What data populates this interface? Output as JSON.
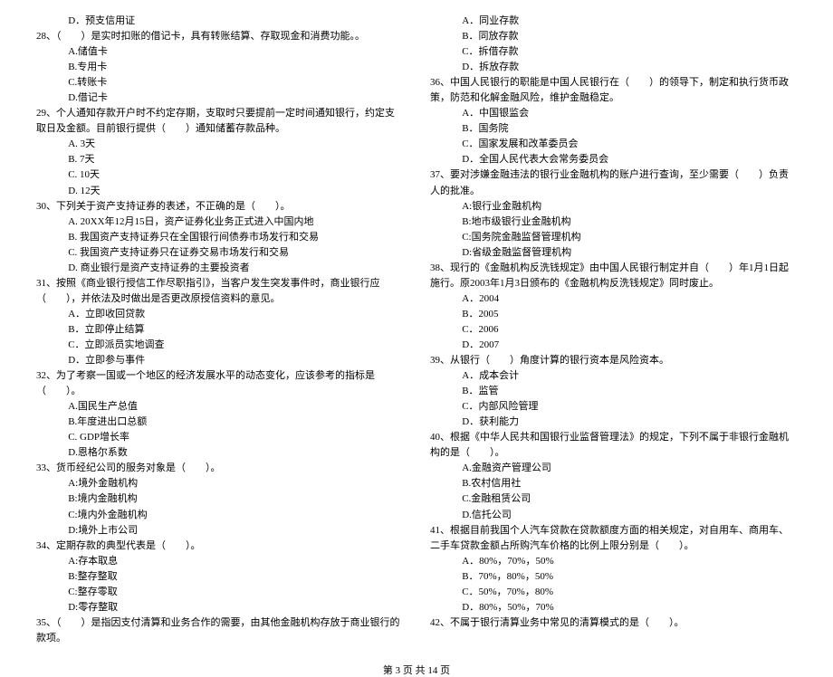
{
  "left": {
    "q27d": "D．预支信用证",
    "q28": "28、（　　）是实时扣账的借记卡，具有转账结算、存取现金和消费功能。。",
    "q28a": "A.储值卡",
    "q28b": "B.专用卡",
    "q28c": "C.转账卡",
    "q28d": "D.借记卡",
    "q29": "29、个人通知存款开户时不约定存期，支取时只要提前一定时间通知银行，约定支取日及金额。目前银行提供（　　）通知储蓄存款品种。",
    "q29a": "A. 3天",
    "q29b": "B. 7天",
    "q29c": "C. 10天",
    "q29d": "D. 12天",
    "q30": "30、下列关于资产支持证券的表述，不正确的是（　　）。",
    "q30a": "A. 20XX年12月15日，资产证券化业务正式进入中国内地",
    "q30b": "B. 我国资产支持证券只在全国银行间债券市场发行和交易",
    "q30c": "C. 我国资产支持证券只在证券交易市场发行和交易",
    "q30d": "D. 商业银行是资产支持证券的主要投资者",
    "q31": "31、按照《商业银行授信工作尽职指引》，当客户发生突发事件时，商业银行应（　　），并依法及时做出是否更改原授信资料的意见。",
    "q31a": "A．立即收回贷款",
    "q31b": "B．立即停止结算",
    "q31c": "C．立即派员实地调查",
    "q31d": "D．立即参与事件",
    "q32": "32、为了考察一国或一个地区的经济发展水平的动态变化，应该参考的指标是（　　）。",
    "q32a": "A.国民生产总值",
    "q32b": "B.年度进出口总额",
    "q32c": "C. GDP增长率",
    "q32d": "D.恩格尔系数",
    "q33": "33、货币经纪公司的服务对象是（　　）。",
    "q33a": "A:境外金融机构",
    "q33b": "B:境内金融机构",
    "q33c": "C:境内外金融机构",
    "q33d": "D:境外上市公司",
    "q34": "34、定期存款的典型代表是（　　）。",
    "q34a": "A:存本取息",
    "q34b": "B:整存整取",
    "q34c": "C:整存零取",
    "q34d": "D:零存整取",
    "q35": "35、（　　）是指因支付清算和业务合作的需要，由其他金融机构存放于商业银行的款项。"
  },
  "right": {
    "q35a": "A．同业存款",
    "q35b": "B．同放存款",
    "q35c": "C．拆借存款",
    "q35d": "D．拆放存款",
    "q36": "36、中国人民银行的职能是中国人民银行在（　　）的领导下，制定和执行货币政策，防范和化解金融风险，维护金融稳定。",
    "q36a": "A．中国银监会",
    "q36b": "B．国务院",
    "q36c": "C．国家发展和改革委员会",
    "q36d": "D．全国人民代表大会常务委员会",
    "q37": "37、要对涉嫌金融违法的银行业金融机构的账户进行查询，至少需要（　　）负责人的批准。",
    "q37a": "A:银行业金融机构",
    "q37b": "B:地市级银行业金融机构",
    "q37c": "C:国务院金融监督管理机构",
    "q37d": "D:省级金融监督管理机构",
    "q38": "38、现行的《金融机构反洗钱规定》由中国人民银行制定并自（　　）年1月1日起施行。原2003年1月3日颁布的《金融机构反洗钱规定》同时废止。",
    "q38a": "A．2004",
    "q38b": "B．2005",
    "q38c": "C．2006",
    "q38d": "D．2007",
    "q39": "39、从银行（　　）角度计算的银行资本是风险资本。",
    "q39a": "A．成本会计",
    "q39b": "B．监管",
    "q39c": "C．内部风险管理",
    "q39d": "D．获利能力",
    "q40": "40、根据《中华人民共和国银行业监督管理法》的规定，下列不属于非银行金融机构的是（　　）。",
    "q40a": "A.金融资产管理公司",
    "q40b": "B.农村信用社",
    "q40c": "C.金融租赁公司",
    "q40d": "D.信托公司",
    "q41": "41、根据目前我国个人汽车贷款在贷款额度方面的相关规定，对自用车、商用车、二手车贷款金额占所购汽车价格的比例上限分别是（　　）。",
    "q41a": "A．80%，70%，50%",
    "q41b": "B．70%，80%，50%",
    "q41c": "C．50%，70%，80%",
    "q41d": "D．80%，50%，70%",
    "q42": "42、不属于银行清算业务中常见的清算模式的是（　　）。"
  },
  "footer": "第 3 页 共 14 页"
}
